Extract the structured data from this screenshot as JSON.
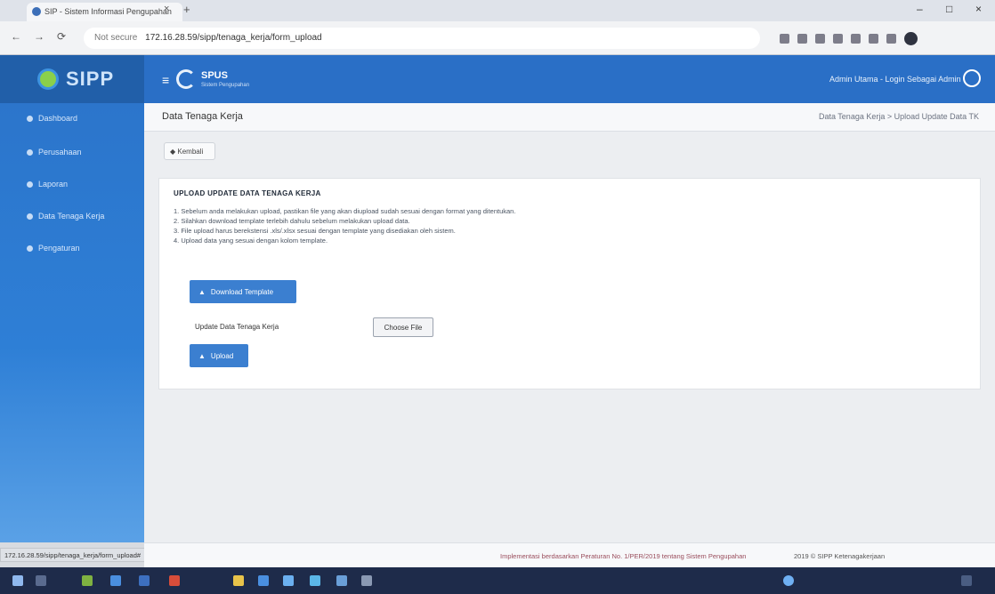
{
  "browser": {
    "tab_title": "SIP - Sistem Informasi Pengupahan",
    "tab_close": "×",
    "new_tab": "+",
    "url_secure": "Not secure",
    "url": "172.16.28.59/sipp/tenaga_kerja/form_upload",
    "window_controls": [
      "–",
      "□",
      "×"
    ],
    "nav": [
      "←",
      "→",
      "⟳"
    ]
  },
  "sidebar": {
    "logo": "SIPP",
    "items": [
      {
        "label": "Dashboard"
      },
      {
        "label": "Perusahaan"
      },
      {
        "label": "Laporan"
      },
      {
        "label": "Data Tenaga Kerja"
      },
      {
        "label": "Pengaturan"
      }
    ]
  },
  "header": {
    "hamburger": "≡",
    "brand": "SPUS",
    "brand_sub": "Sistem Pengupahan",
    "user": "Admin Utama - Login Sebagai Admin"
  },
  "content": {
    "page_title": "Data Tenaga Kerja",
    "breadcrumb": "Data Tenaga Kerja > Upload Update Data TK",
    "back_button": "◆ Kembali",
    "card": {
      "title": "UPLOAD UPDATE DATA TENAGA KERJA",
      "instructions": [
        "1. Sebelum anda melakukan upload, pastikan file yang akan diupload sudah sesuai dengan format yang ditentukan.",
        "2. Silahkan download template terlebih dahulu sebelum melakukan upload data.",
        "3. File upload harus berekstensi .xls/.xlsx sesuai dengan template yang disediakan oleh sistem.",
        "4. Upload data yang sesuai dengan kolom template."
      ],
      "download_button": "Download Template",
      "file_label": "Update Data Tenaga Kerja",
      "file_button": "Choose File",
      "upload_button": "Upload"
    }
  },
  "footer": {
    "note": "Implementasi berdasarkan Peraturan No. 1/PER/2019 tentang Sistem Pengupahan",
    "copyright": "2019 © SIPP Ketenagakerjaan",
    "status_url": "172.16.28.59/sipp/tenaga_kerja/form_upload#"
  },
  "colors": {
    "header": "#2a6fc6",
    "sidebar": "#2e7fd6",
    "primary_button": "#3b7fd0",
    "taskbar": "#1e2b4a"
  }
}
